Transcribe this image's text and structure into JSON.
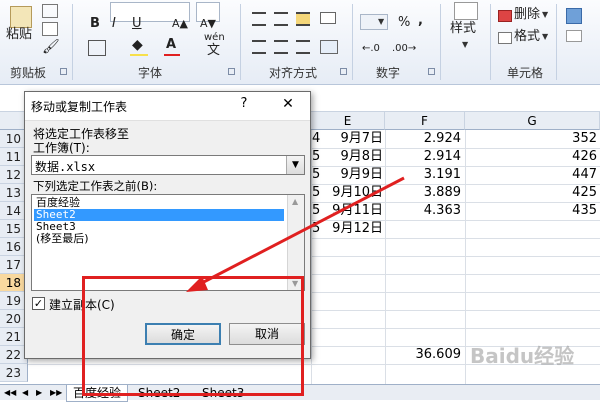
{
  "ribbon": {
    "paste_label": "粘贴",
    "group_clipboard": "剪贴板",
    "group_font": "字体",
    "group_alignment": "对齐方式",
    "group_number": "数字",
    "group_cells": "单元格",
    "bold": "B",
    "italic": "I",
    "underline": "U",
    "font_color_letter": "A",
    "wen_char": "wén",
    "wen_letter": "文",
    "percent": "%",
    "comma": ",",
    "style_label": "样式",
    "delete_label": "删除",
    "format_label": "格式"
  },
  "sheet": {
    "column_headers": [
      "E",
      "F",
      "G"
    ],
    "row_numbers": [
      "10",
      "11",
      "12",
      "13",
      "14",
      "15",
      "16",
      "17",
      "18",
      "19",
      "20",
      "21",
      "22",
      "23"
    ],
    "selected_row": "18",
    "d_partial": [
      "4",
      "5",
      "5",
      "5",
      "5",
      "5"
    ],
    "e_values": [
      "9月7日",
      "9月8日",
      "9月9日",
      "9月10日",
      "9月11日",
      "9月12日"
    ],
    "f_values": [
      "2.924",
      "2.914",
      "3.191",
      "3.889",
      "4.363"
    ],
    "g_values": [
      "352",
      "426",
      "447",
      "425",
      "435"
    ],
    "f22_value": "36.609",
    "tabs": [
      "百度经验",
      "Sheet2",
      "Sheet3"
    ],
    "nav_arrows": [
      "◀◀",
      "◀",
      "▶",
      "▶▶"
    ]
  },
  "dialog": {
    "title": "移动或复制工作表",
    "help": "?",
    "close": "✕",
    "move_to_label": "将选定工作表移至",
    "workbook_label": "工作簿(T):",
    "workbook_value": "数据.xlsx",
    "before_sheet_label": "下列选定工作表之前(B):",
    "sheet_list": [
      "百度经验",
      "Sheet2",
      "Sheet3",
      "(移至最后)"
    ],
    "selected_index": 1,
    "copy_checkbox_label": "建立副本(C)",
    "copy_checked": true,
    "ok_label": "确定",
    "cancel_label": "取消"
  },
  "watermark": "Baidu经验",
  "colors": {
    "selection": "#3399ff",
    "annotation_red": "#e02020",
    "row_selected": "#f9d99f"
  }
}
